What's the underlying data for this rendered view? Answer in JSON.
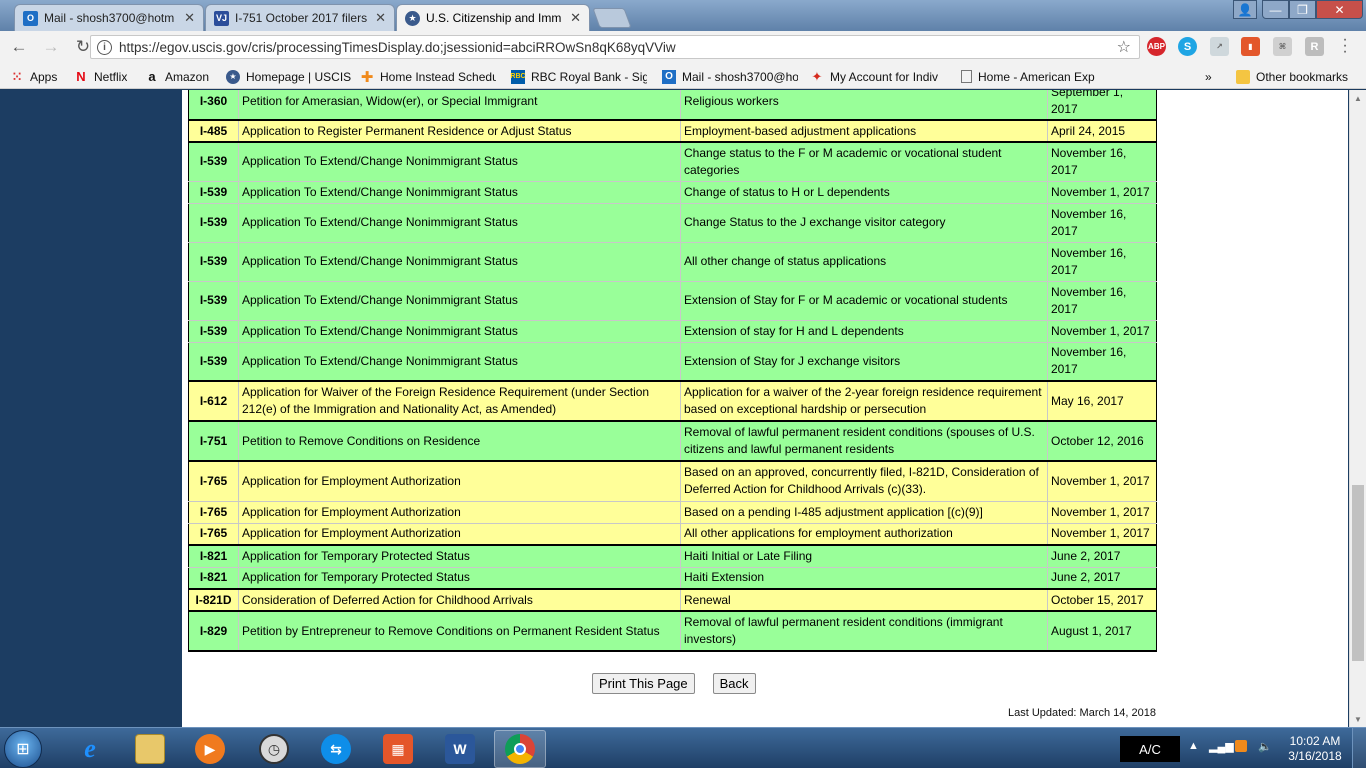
{
  "browser": {
    "tabs": [
      {
        "title": "Mail - shosh3700@hotm",
        "icon": "outlook-icon",
        "active": false
      },
      {
        "title": "I-751 October 2017 filers",
        "icon": "vj-icon",
        "active": false
      },
      {
        "title": "U.S. Citizenship and Imm",
        "icon": "dhs-seal-icon",
        "active": true
      }
    ],
    "url": "https://egov.uscis.gov/cris/processingTimesDisplay.do;jsessionid=abciRROwSn8qK68yqVViw",
    "extensions": [
      "adblock-icon",
      "skype-icon",
      "extension-icon",
      "office-icon",
      "pdf-icon",
      "extension-r-icon"
    ],
    "bookmarks": [
      {
        "label": "Apps",
        "icon": "apps-grid-icon"
      },
      {
        "label": "Netflix",
        "icon": "netflix-icon"
      },
      {
        "label": "Amazon",
        "icon": "amazon-icon"
      },
      {
        "label": "Homepage | USCIS",
        "icon": "dhs-seal-icon"
      },
      {
        "label": "Home Instead Schedu",
        "icon": "home-instead-icon"
      },
      {
        "label": "RBC Royal Bank - Sig",
        "icon": "rbc-icon"
      },
      {
        "label": "Mail - shosh3700@ho",
        "icon": "outlook-icon"
      },
      {
        "label": "My Account for Indiv",
        "icon": "maple-leaf-icon"
      },
      {
        "label": "Home - American Exp",
        "icon": "page-icon"
      }
    ],
    "overflow": "»",
    "other_bookmarks": "Other bookmarks"
  },
  "rows": [
    {
      "form": "I-360",
      "title": "Petition for Amerasian, Widow(er), or Special Immigrant",
      "category": "Religious workers",
      "date": "September 1, 2017",
      "color": "green",
      "sep": false
    },
    {
      "form": "I-485",
      "title": "Application to Register Permanent Residence or Adjust Status",
      "category": "Employment-based adjustment applications",
      "date": "April 24, 2015",
      "color": "yellow",
      "sep": true
    },
    {
      "form": "I-539",
      "title": "Application To Extend/Change Nonimmigrant Status",
      "category": "Change status to the F or M academic or vocational student categories",
      "date": "November 16, 2017",
      "color": "green",
      "sep": true
    },
    {
      "form": "I-539",
      "title": "Application To Extend/Change Nonimmigrant Status",
      "category": "Change of status to H or L dependents",
      "date": "November 1, 2017",
      "color": "green",
      "sep": false
    },
    {
      "form": "I-539",
      "title": "Application To Extend/Change Nonimmigrant Status",
      "category": "Change Status to the J exchange visitor category",
      "date": "November 16, 2017",
      "color": "green",
      "sep": false
    },
    {
      "form": "I-539",
      "title": "Application To Extend/Change Nonimmigrant Status",
      "category": "All other change of status applications",
      "date": "November 16, 2017",
      "color": "green",
      "sep": false
    },
    {
      "form": "I-539",
      "title": "Application To Extend/Change Nonimmigrant Status",
      "category": "Extension of Stay for F or M academic or vocational students",
      "date": "November 16, 2017",
      "color": "green",
      "sep": false
    },
    {
      "form": "I-539",
      "title": "Application To Extend/Change Nonimmigrant Status",
      "category": "Extension of stay for H and L dependents",
      "date": "November 1, 2017",
      "color": "green",
      "sep": false
    },
    {
      "form": "I-539",
      "title": "Application To Extend/Change Nonimmigrant Status",
      "category": "Extension of Stay for J exchange visitors",
      "date": "November 16, 2017",
      "color": "green",
      "sep": false
    },
    {
      "form": "I-612",
      "title": "Application for Waiver of the Foreign Residence Requirement (under Section 212(e) of the Immigration and Nationality Act, as Amended)",
      "category": "Application for a waiver of the 2-year foreign residence requirement based on exceptional hardship or persecution",
      "date": "May 16, 2017",
      "color": "yellow",
      "sep": true
    },
    {
      "form": "I-751",
      "title": "Petition to Remove Conditions on Residence",
      "category": "Removal of lawful permanent resident conditions (spouses of U.S. citizens and lawful permanent residents",
      "date": "October 12, 2016",
      "color": "green",
      "sep": true
    },
    {
      "form": "I-765",
      "title": "Application for Employment Authorization",
      "category": "Based on an approved, concurrently filed, I-821D, Consideration of Deferred Action for Childhood Arrivals (c)(33).",
      "date": "November 1, 2017",
      "color": "yellow",
      "sep": true
    },
    {
      "form": "I-765",
      "title": "Application for Employment Authorization",
      "category": "Based on a pending I-485 adjustment application [(c)(9)]",
      "date": "November 1, 2017",
      "color": "yellow",
      "sep": false
    },
    {
      "form": "I-765",
      "title": "Application for Employment Authorization",
      "category": "All other applications for employment authorization",
      "date": "November 1, 2017",
      "color": "yellow",
      "sep": false
    },
    {
      "form": "I-821",
      "title": "Application for Temporary Protected Status",
      "category": "Haiti Initial or Late Filing",
      "date": "June 2, 2017",
      "color": "green",
      "sep": true
    },
    {
      "form": "I-821",
      "title": "Application for Temporary Protected Status",
      "category": "Haiti Extension",
      "date": "June 2, 2017",
      "color": "green",
      "sep": false
    },
    {
      "form": "I-821D",
      "title": "Consideration of Deferred Action for Childhood Arrivals",
      "category": "Renewal",
      "date": "October 15, 2017",
      "color": "yellow",
      "sep": true
    },
    {
      "form": "I-829",
      "title": "Petition by Entrepreneur to Remove Conditions on Permanent Resident Status",
      "category": "Removal of lawful permanent resident conditions (immigrant investors)",
      "date": "August 1, 2017",
      "color": "green",
      "sep": true
    }
  ],
  "page": {
    "print_label": "Print This Page",
    "back_label": "Back",
    "last_updated": "Last Updated: March 14, 2018"
  },
  "taskbar": {
    "ac_label": "A/C",
    "time": "10:02 AM",
    "date": "3/16/2018",
    "apps": [
      "internet-explorer-icon",
      "file-explorer-icon",
      "media-player-icon",
      "clock-app-icon",
      "teamviewer-icon",
      "presentation-app-icon",
      "word-icon",
      "chrome-icon"
    ]
  },
  "colors": {
    "green": "#99ff99",
    "yellow": "#ffff99",
    "accent": "#1c3d62"
  }
}
